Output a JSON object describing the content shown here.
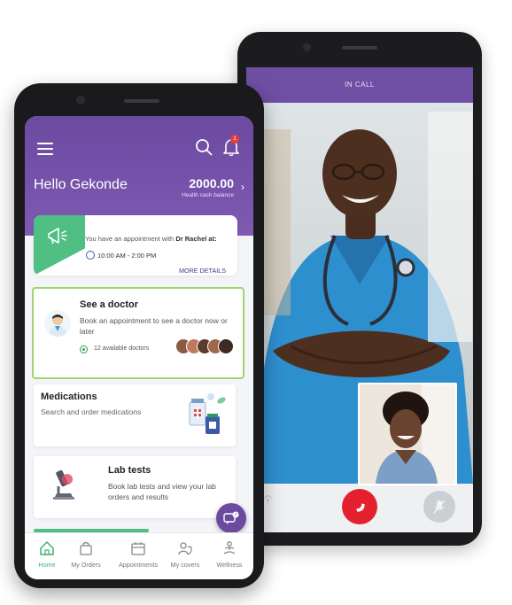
{
  "call": {
    "header": "IN CALL",
    "controls": {
      "camera_icon": "camera-icon",
      "end_icon": "end-call-icon",
      "mute_icon": "mute-icon"
    }
  },
  "app": {
    "colors": {
      "brand": "#6c4aa0",
      "accent": "#4fbf83",
      "badge": "#e53c3c"
    },
    "header": {
      "greeting": "Hello Gekonde",
      "balance": "2000.00",
      "balance_label": "Health cash balance",
      "notification_count": "1"
    },
    "appointment": {
      "text_prefix": "You have an appointment with",
      "doctor": "Dr Rachel at:",
      "time": "10:00 AM - 2:00 PM",
      "more": "MORE DETAILS"
    },
    "see_doctor": {
      "title": "See a doctor",
      "desc": "Book an appointment to see a doctor now or later",
      "available": "12 available doctors"
    },
    "medications": {
      "title": "Medications",
      "desc": "Search and order medications"
    },
    "lab_tests": {
      "title": "Lab tests",
      "desc": "Book lab tests and view your lab orders and results"
    },
    "nav": [
      {
        "label": "Home",
        "icon": "home-icon"
      },
      {
        "label": "My Orders",
        "icon": "bag-icon"
      },
      {
        "label": "Appointments",
        "icon": "calendar-icon"
      },
      {
        "label": "My covers",
        "icon": "shield-user-icon"
      },
      {
        "label": "Wellness",
        "icon": "meditation-icon"
      }
    ]
  }
}
